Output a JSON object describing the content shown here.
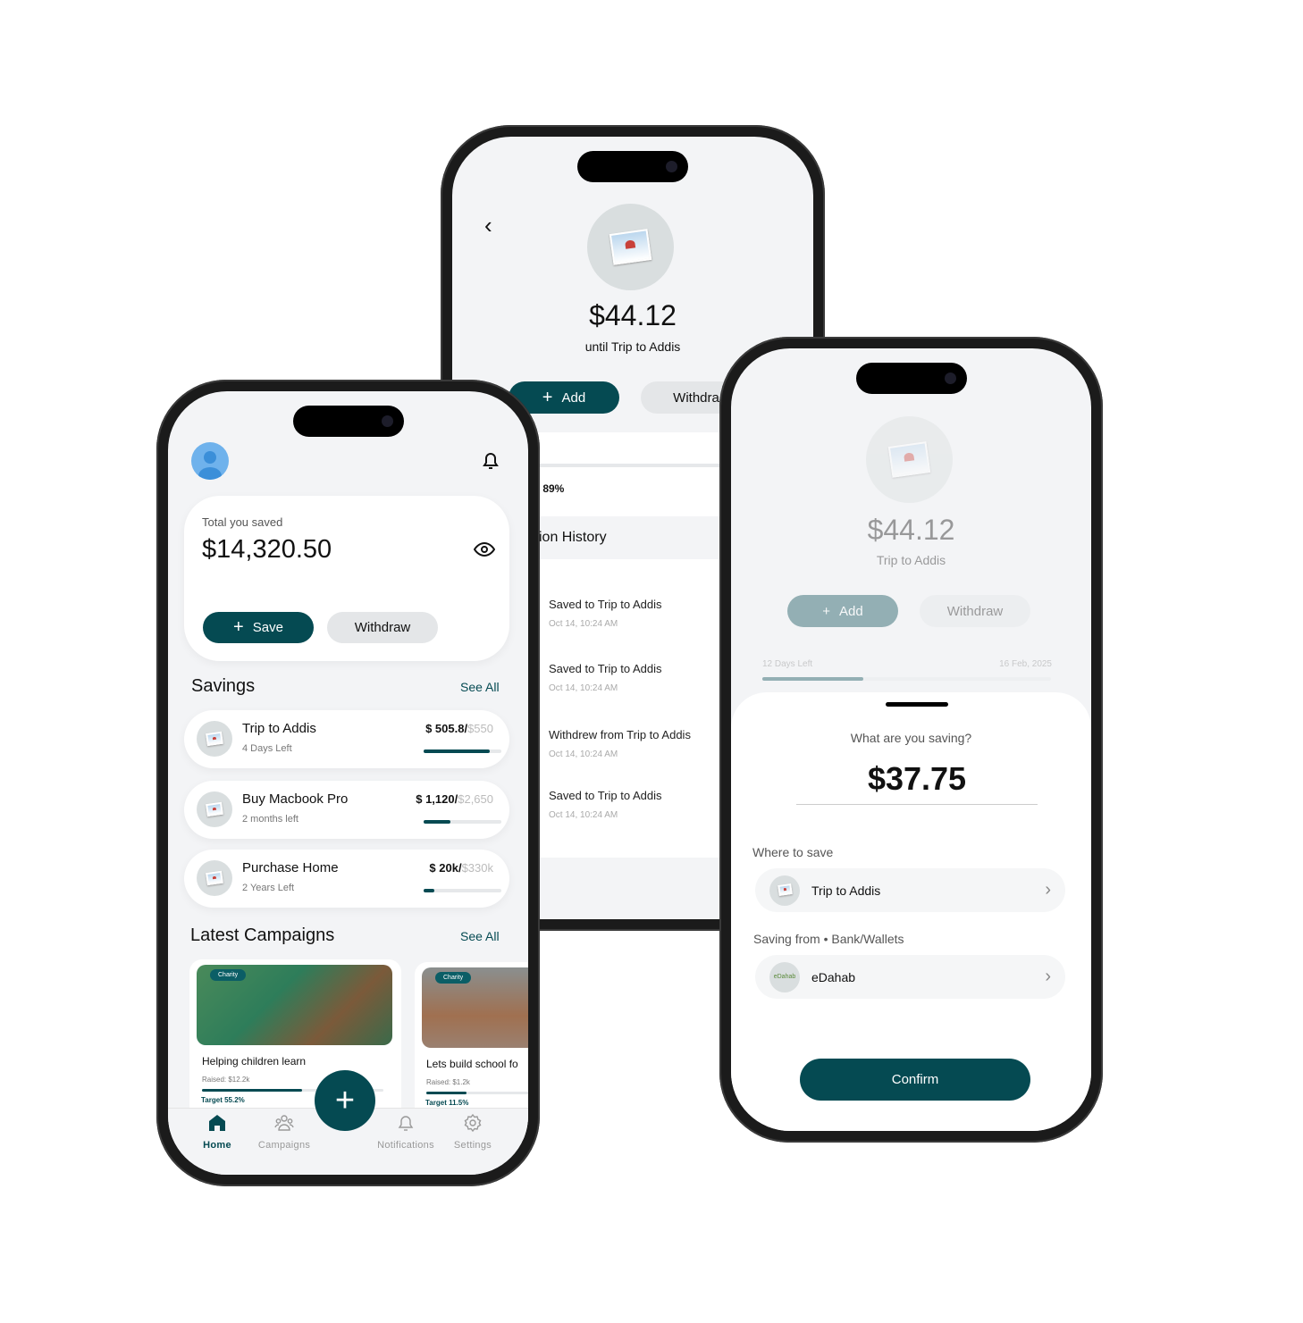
{
  "colors": {
    "primary": "#054a52",
    "background": "#f3f4f6"
  },
  "detail": {
    "amount": "$44.12",
    "subtitle": "until Trip to Addis",
    "add_label": "Add",
    "withdraw_label": "Withdra",
    "target_label": "t 89%",
    "progress_fraction": 0.33,
    "history_title": "ion History",
    "transactions": [
      {
        "title": "Saved to Trip to Addis",
        "time": "Oct 14, 10:24 AM"
      },
      {
        "title": "Saved to Trip to Addis",
        "time": "Oct 14, 10:24 AM"
      },
      {
        "title": "Withdrew from Trip to Addis",
        "time": "Oct 14, 10:24 AM"
      },
      {
        "title": "Saved to Trip to Addis",
        "time": "Oct 14, 10:24 AM"
      }
    ]
  },
  "home": {
    "total_label": "Total you saved",
    "total_amount": "$14,320.50",
    "save_label": "Save",
    "withdraw_label": "Withdraw",
    "savings_title": "Savings",
    "see_all": "See All",
    "savings": [
      {
        "title": "Trip to Addis",
        "subtitle": "4 Days Left",
        "saved": "$ 505.8/",
        "goal": "$550",
        "progress": 0.85
      },
      {
        "title": "Buy Macbook Pro",
        "subtitle": "2 months left",
        "saved": "$ 1,120/",
        "goal": "$2,650",
        "progress": 0.35
      },
      {
        "title": "Purchase Home",
        "subtitle": "2 Years Left",
        "saved": "$ 20k/",
        "goal": "$330k",
        "progress": 0.14
      }
    ],
    "campaigns_title": "Latest Campaigns",
    "campaigns": [
      {
        "tag": "Charity",
        "title": "Helping children learn",
        "raised": "Raised: $12.2k",
        "target": "Target 55.2%",
        "progress": 0.552
      },
      {
        "tag": "Charity",
        "title": "Lets build school fo",
        "raised": "Raised: $1.2k",
        "target": "Target 11.5%",
        "progress": 0.115
      }
    ],
    "nav": {
      "home": "Home",
      "campaigns": "Campaigns",
      "notifications": "Notifications",
      "settings": "Settings"
    }
  },
  "sheet": {
    "bg_amount": "$44.12",
    "bg_subtitle": "Trip to Addis",
    "bg_add": "Add",
    "bg_withdraw": "Withdraw",
    "days_left": "12 Days Left",
    "date": "16 Feb, 2025",
    "bg_progress": 0.35,
    "question": "What are you saving?",
    "amount": "$37.75",
    "where_label": "Where to save",
    "where_value": "Trip to Addis",
    "from_label": "Saving from • Bank/Wallets",
    "from_value": "eDahab",
    "from_logo": "eDahab",
    "confirm_label": "Confirm"
  }
}
